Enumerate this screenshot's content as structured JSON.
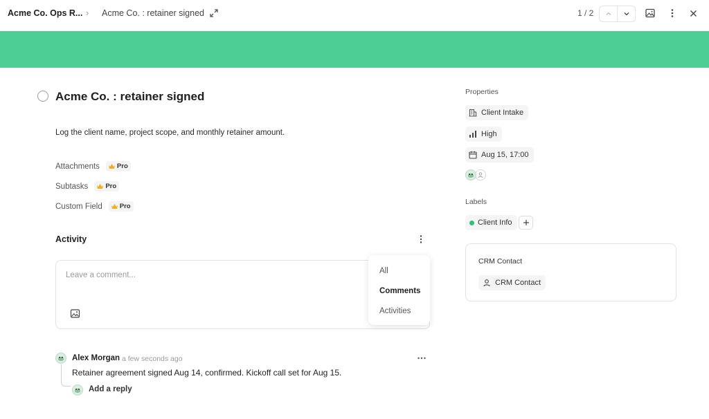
{
  "header": {
    "breadcrumb_root": "Acme Co. Ops R...",
    "breadcrumb_task": "Acme Co. : retainer signed",
    "pager": "1 / 2"
  },
  "colors": {
    "cover": "#4cce95",
    "label_dot": "#30c075"
  },
  "task": {
    "title": "Acme Co. : retainer signed",
    "description": "Log the client name, project scope, and monthly retainer amount."
  },
  "fields": [
    {
      "label": "Attachments",
      "badge": "Pro"
    },
    {
      "label": "Subtasks",
      "badge": "Pro"
    },
    {
      "label": "Custom Field",
      "badge": "Pro"
    }
  ],
  "activity": {
    "title": "Activity",
    "comment_placeholder": "Leave a comment...",
    "filter_menu": [
      "All",
      "Comments",
      "Activities"
    ],
    "filter_selected": "Comments"
  },
  "comment": {
    "author": "Alex Morgan",
    "time": "a few seconds ago",
    "text": "Retainer agreement signed Aug 14, confirmed. Kickoff call set for Aug 15.",
    "reply_label": "Add a reply"
  },
  "properties": {
    "heading": "Properties",
    "list": "Client Intake",
    "priority": "High",
    "due": "Aug 15, 17:00"
  },
  "labels": {
    "heading": "Labels",
    "items": [
      "Client Info"
    ]
  },
  "crm": {
    "title": "CRM Contact",
    "chip": "CRM Contact"
  }
}
